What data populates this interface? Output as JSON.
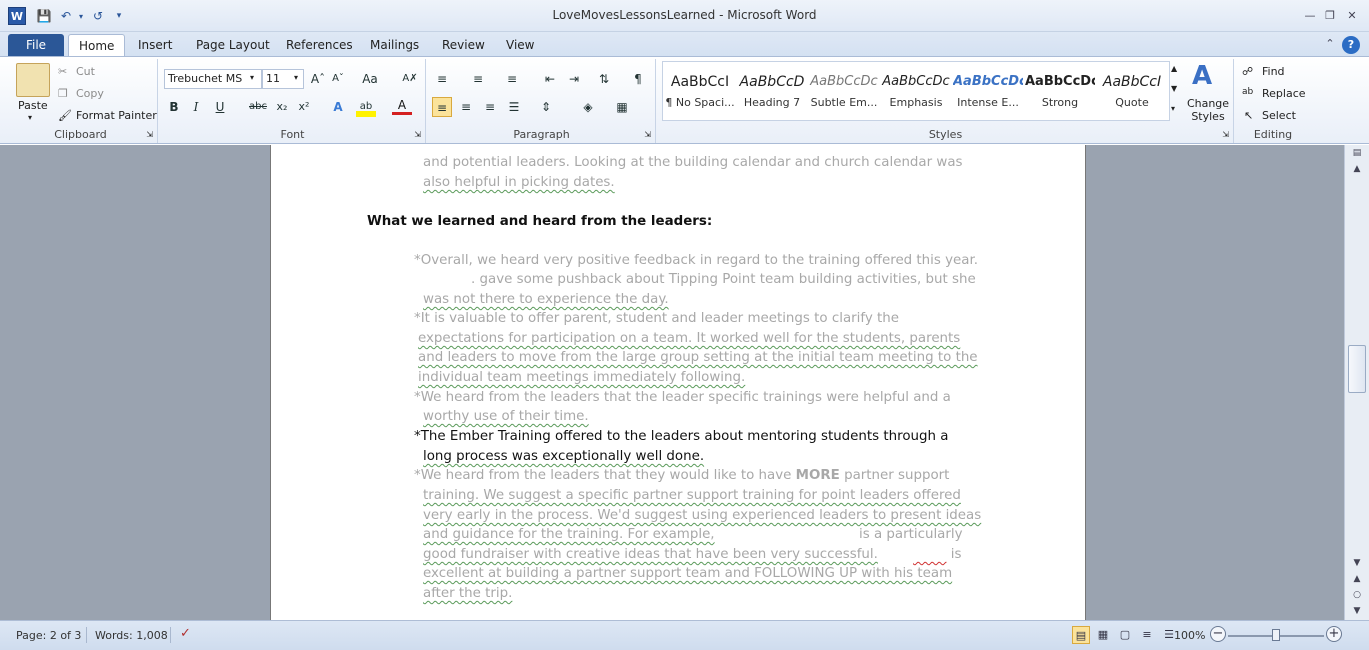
{
  "window": {
    "title": "LoveMovesLessonsLearned  -  Microsoft Word",
    "app_icon": "W"
  },
  "tabs": [
    {
      "label": "File"
    },
    {
      "label": "Home"
    },
    {
      "label": "Insert"
    },
    {
      "label": "Page Layout"
    },
    {
      "label": "References"
    },
    {
      "label": "Mailings"
    },
    {
      "label": "Review"
    },
    {
      "label": "View"
    }
  ],
  "ribbon": {
    "clipboard": {
      "label": "Clipboard",
      "paste": "Paste",
      "cut": "Cut",
      "copy": "Copy",
      "format_painter": "Format Painter"
    },
    "font": {
      "label": "Font",
      "font_name": "Trebuchet MS",
      "font_size": "11"
    },
    "paragraph": {
      "label": "Paragraph"
    },
    "styles": {
      "label": "Styles",
      "items": [
        {
          "sample": "AaBbCcI",
          "name": "¶ No Spaci..."
        },
        {
          "sample": "AaBbCcD",
          "name": "Heading 7"
        },
        {
          "sample": "AaBbCcDc",
          "name": "Subtle Em..."
        },
        {
          "sample": "AaBbCcDc",
          "name": "Emphasis"
        },
        {
          "sample": "AaBbCcDc",
          "name": "Intense E..."
        },
        {
          "sample": "AaBbCcDc",
          "name": "Strong"
        },
        {
          "sample": "AaBbCcI",
          "name": "Quote"
        }
      ],
      "change_styles": "Change Styles"
    },
    "editing": {
      "label": "Editing",
      "find": "Find",
      "replace": "Replace",
      "select": "Select"
    }
  },
  "document": {
    "lines": [
      {
        "text": "and potential leaders.  Looking at the building calendar and church calendar was"
      },
      {
        "text": "also helpful in picking dates."
      },
      {
        "text": "What we learned and heard from the leaders:"
      },
      {
        "text": "*Overall, we heard very positive feedback in regard to the training offered this year."
      },
      {
        "text": ". gave some pushback about Tipping Point team building activities, but she"
      },
      {
        "text": "was not there to experience the day."
      },
      {
        "text": "*It is valuable to offer parent, student and leader meetings to clarify the"
      },
      {
        "text": "expectations for participation on a team.  It worked well for the students, parents"
      },
      {
        "text": "and leaders to move from the large group setting at the initial team meeting to the"
      },
      {
        "text": "individual team meetings immediately following."
      },
      {
        "text": "*We heard from the leaders that the leader specific trainings were helpful and a"
      },
      {
        "text": "worthy use of their time."
      },
      {
        "text": "*The Ember Training offered to the leaders about mentoring students through a"
      },
      {
        "text": "long process was exceptionally well done."
      },
      {
        "text": "*We heard from the leaders that they would like to have "
      },
      {
        "text": "MORE"
      },
      {
        "text": " partner support"
      },
      {
        "text": "training.  We suggest a specific partner support training for point leaders offered"
      },
      {
        "text": "very early in the process.  We'd suggest using experienced leaders to present ideas"
      },
      {
        "text": "and guidance for the training.  For example,"
      },
      {
        "text": "is a particularly"
      },
      {
        "text": "good fundraiser with creative ideas that have been very successful."
      },
      {
        "text": "is"
      },
      {
        "text": "excellent at building a partner support team and FOLLOWING UP with his team"
      },
      {
        "text": "after the trip."
      }
    ]
  },
  "status": {
    "page": "Page: 2 of 3",
    "words": "Words: 1,008",
    "zoom": "100%",
    "zoom_level_percent": 100
  }
}
